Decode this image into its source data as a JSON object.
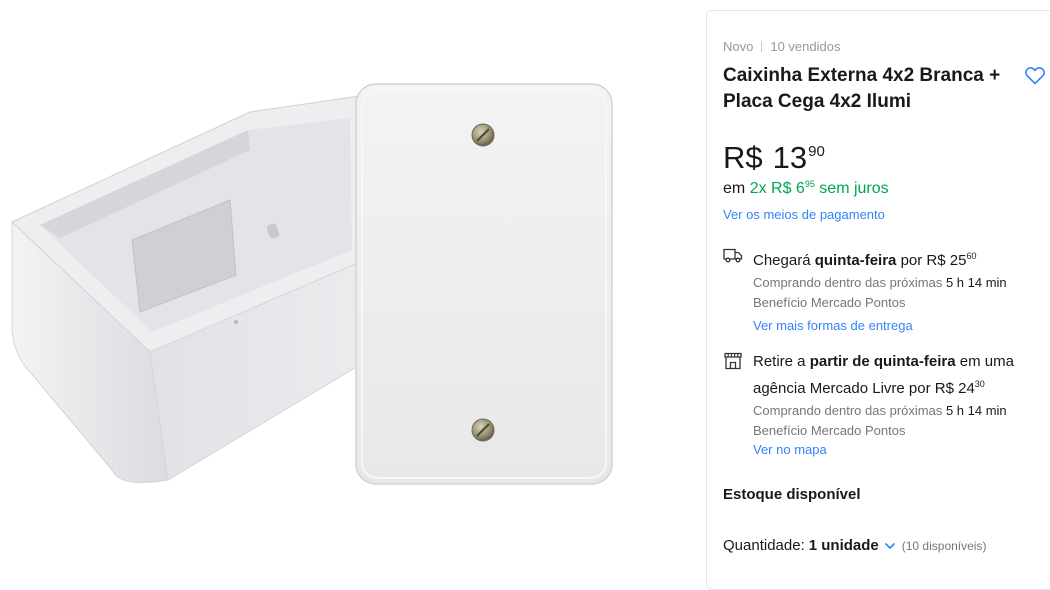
{
  "product": {
    "condition": "Novo",
    "sold": "10 vendidos",
    "title": "Caixinha Externa 4x2 Branca + Placa Cega 4x2 Ilumi",
    "image_alt": "caixinha-externa-e-placa-cega"
  },
  "price": {
    "currency": "R$",
    "integer": "13",
    "cents": "90"
  },
  "installments": {
    "prefix": "em",
    "count": "2x R$ 6",
    "cents": "95",
    "suffix": "sem juros",
    "payment_link": "Ver os meios de pagamento"
  },
  "shipping": {
    "text_1": "Chegará",
    "day": "quinta-feira",
    "text_2": "por R$ 25",
    "cents": "60",
    "buy_within": "Comprando dentro das próximas",
    "time": "5 h 14 min",
    "benefit": "Benefício Mercado Pontos",
    "link": "Ver mais formas de entrega",
    "icon": "truck-icon"
  },
  "pickup": {
    "text_1": "Retire a",
    "bold": "partir de quinta-feira",
    "text_2": "em uma agência Mercado Livre por R$ 24",
    "cents": "30",
    "buy_within": "Comprando dentro das próximas",
    "time": "5 h 14 min",
    "benefit": "Benefício Mercado Pontos",
    "link": "Ver no mapa",
    "icon": "store-icon"
  },
  "stock": {
    "label": "Estoque disponível"
  },
  "quantity": {
    "label": "Quantidade:",
    "value": "1 unidade",
    "available": "(10 disponíveis)"
  },
  "colors": {
    "link": "#3483fa",
    "green": "#00a650"
  }
}
